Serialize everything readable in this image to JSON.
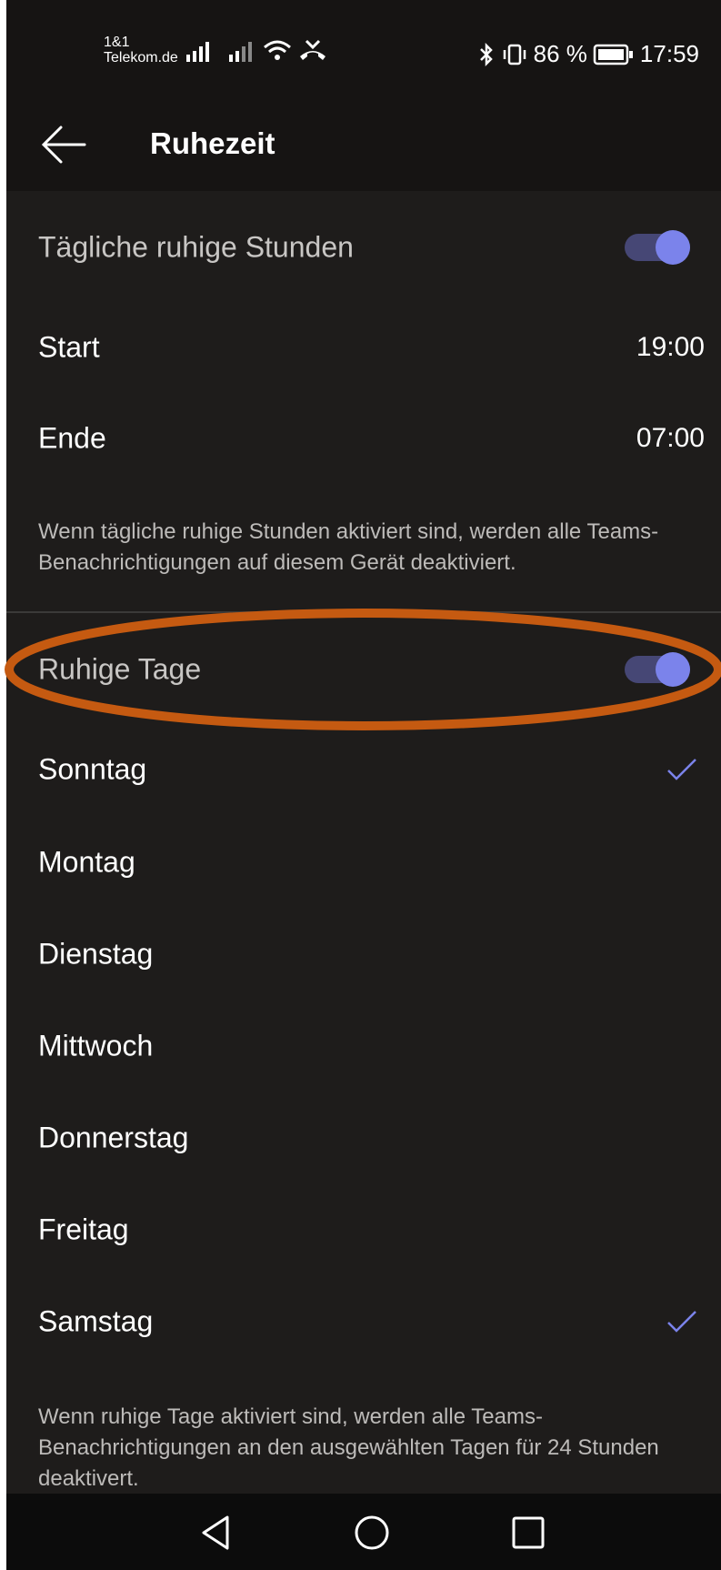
{
  "status_bar": {
    "carrier_line1": "1&1",
    "carrier_line2": "Telekom.de",
    "battery_percent": "86 %",
    "time": "17:59",
    "icons": [
      "signal-icon",
      "signal-icon",
      "wifi-icon",
      "missed-call-icon",
      "bluetooth-icon",
      "vibrate-icon",
      "battery-icon"
    ]
  },
  "app_bar": {
    "title": "Ruhezeit",
    "back_icon": "back-arrow-icon"
  },
  "daily": {
    "toggle_label": "Tägliche ruhige Stunden",
    "toggle_on": true,
    "start_label": "Start",
    "start_value": "19:00",
    "end_label": "Ende",
    "end_value": "07:00",
    "note": "Wenn tägliche ruhige Stunden aktiviert sind, werden alle Teams-Benachrichtigungen auf diesem Gerät deaktiviert."
  },
  "days_section": {
    "toggle_label": "Ruhige Tage",
    "toggle_on": true,
    "days": [
      {
        "label": "Sonntag",
        "checked": true
      },
      {
        "label": "Montag",
        "checked": false
      },
      {
        "label": "Dienstag",
        "checked": false
      },
      {
        "label": "Mittwoch",
        "checked": false
      },
      {
        "label": "Donnerstag",
        "checked": false
      },
      {
        "label": "Freitag",
        "checked": false
      },
      {
        "label": "Samstag",
        "checked": true
      }
    ],
    "note": "Wenn ruhige Tage aktiviert sind, werden alle Teams-Benachrichtigungen an den ausgewählten Tagen für 24 Stunden deaktivert."
  },
  "nav_bar": {
    "icons": [
      "back-triangle-icon",
      "home-circle-icon",
      "recents-square-icon"
    ]
  },
  "colors": {
    "accent": "#7b83eb",
    "toggle_track": "#464775",
    "background": "#1e1c1b",
    "annotation": "#c55a11"
  }
}
